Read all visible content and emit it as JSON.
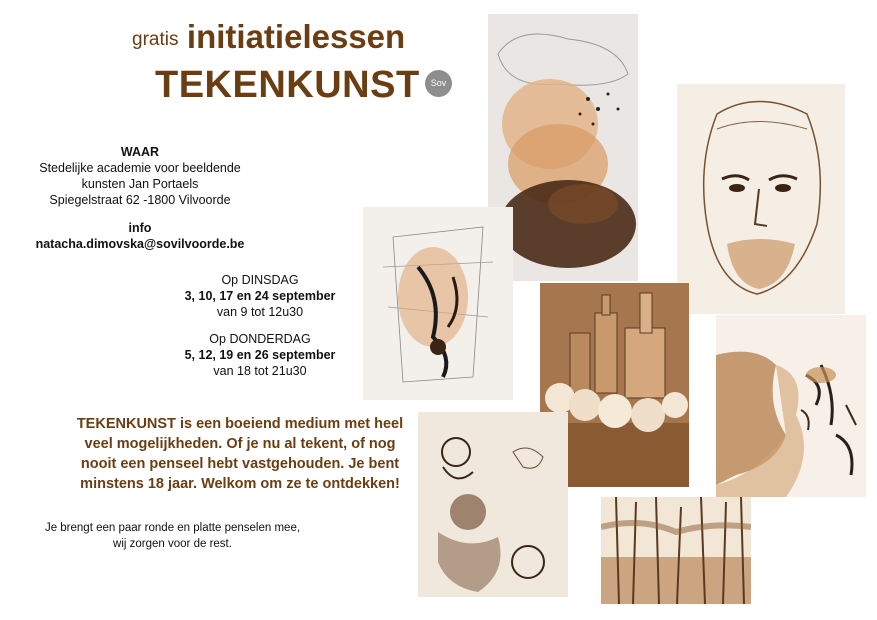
{
  "header": {
    "small_title": "gratis",
    "big_title": "initiatielessen",
    "subtitle": "TEKENKUNST",
    "logo_text": "Sov"
  },
  "info": {
    "waar_label": "WAAR",
    "address_line1": "Stedelijke academie voor beeldende",
    "address_line2": "kunsten Jan Portaels",
    "address_line3": "Spiegelstraat 62 -1800 Vilvoorde",
    "info_label": "info",
    "email": "natacha.dimovska@sovilvoorde.be"
  },
  "schedule": {
    "day1_label": "Op DINSDAG",
    "day1_dates": "3, 10, 17 en 24 september",
    "day1_time": "van 9 tot 12u30",
    "day2_label": "Op DONDERDAG",
    "day2_dates": "5, 12, 19 en 26 september",
    "day2_time": "van 18 tot 21u30"
  },
  "description": {
    "line1": "TEKENKUNST is een boeiend medium met heel",
    "line2": "veel mogelijkheden.  Of je nu al tekent, of nog",
    "line3": "nooit een penseel hebt vastgehouden. Je bent",
    "line4": "minstens 18 jaar. Welkom om ze te ontdekken!"
  },
  "footer": {
    "line1": "Je brengt een paar ronde en platte penselen mee,",
    "line2": "wij zorgen voor de rest."
  },
  "colors": {
    "brand_brown": "#6b3d12",
    "sepia": "#8a5a32",
    "logo_gray": "#8e8e8e"
  }
}
